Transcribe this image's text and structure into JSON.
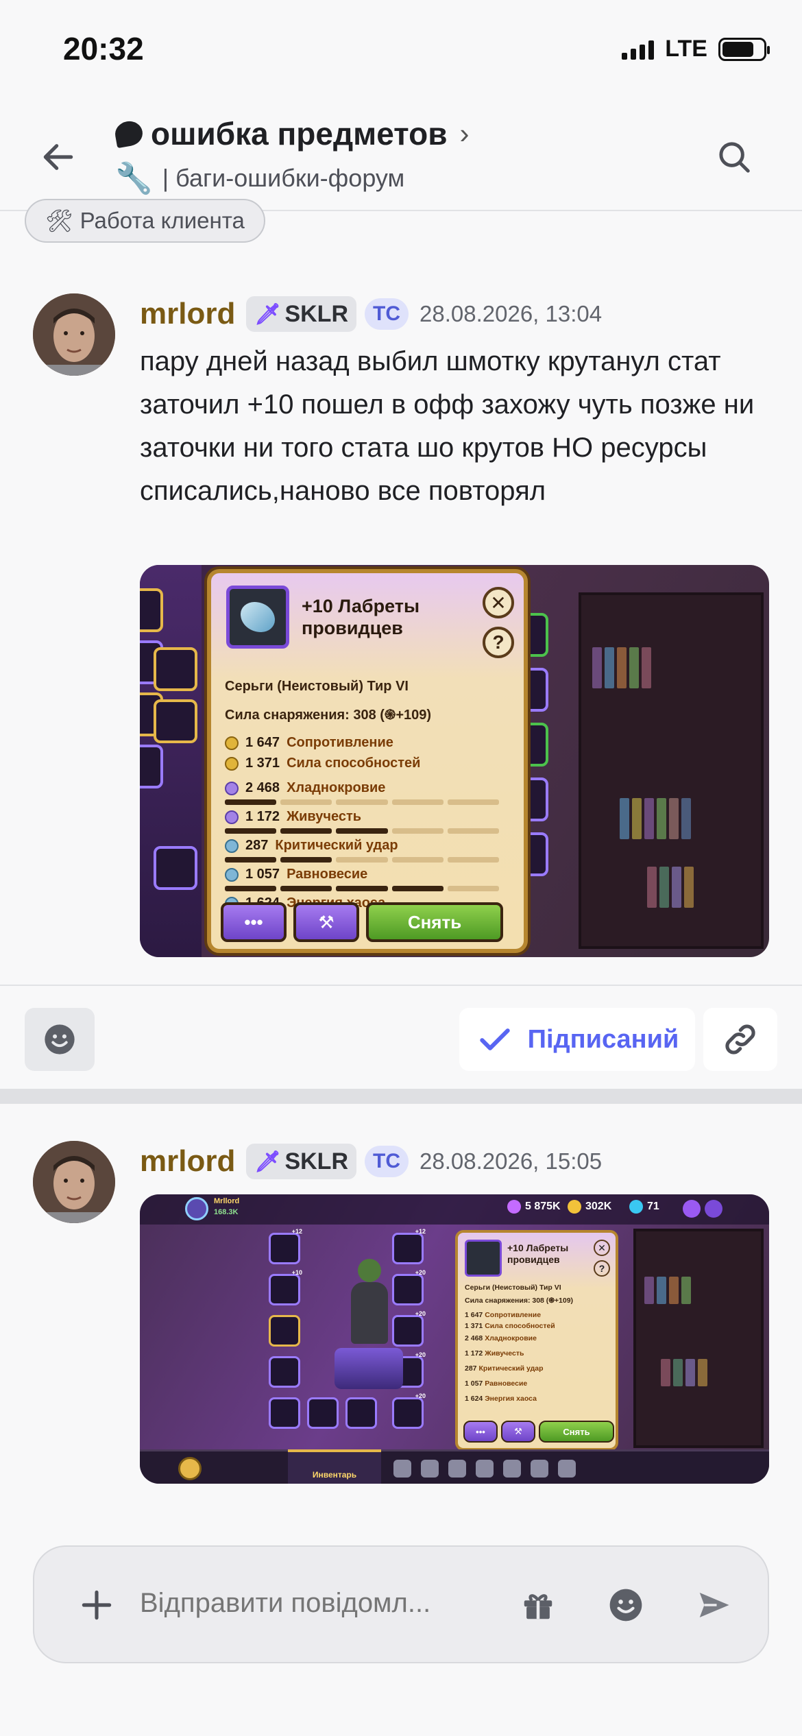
{
  "status_bar": {
    "time": "20:32",
    "network": "LTE"
  },
  "header": {
    "title": "ошибка предметов",
    "subtitle": "| баги-ошибки-форум"
  },
  "tag": {
    "label": "Работа клиента"
  },
  "messages": [
    {
      "username": "mrlord",
      "role": "SKLR",
      "op_badge": "TC",
      "timestamp": "28.08.2026, 13:04",
      "text": "пару дней назад выбил шмотку крутанул стат заточил +10 пошел в офф захожу чуть позже ни заточки ни того стата шо крутов НО ресурсы списались,наново все повторял"
    },
    {
      "username": "mrlord",
      "role": "SKLR",
      "op_badge": "TC",
      "timestamp": "28.08.2026, 15:05"
    }
  ],
  "game_card": {
    "title": "+10 Лабреты провидцев",
    "subtitle": "Серьги (Неистовый) Тир VI",
    "power": "Сила снаряжения: 308 (",
    "power_bonus": "+109)",
    "close": "✕",
    "help": "?",
    "stats": [
      {
        "value": "1 647",
        "label": "Сопротивление"
      },
      {
        "value": "1 371",
        "label": "Сила способностей"
      },
      {
        "value": "2 468",
        "label": "Хладнокровие"
      },
      {
        "value": "1 172",
        "label": "Живучесть"
      },
      {
        "value": "287",
        "label": "Критический удар"
      },
      {
        "value": "1 057",
        "label": "Равновесие"
      },
      {
        "value": "1 624",
        "label": "Энергия хаоса"
      }
    ],
    "more_button": "•••",
    "remove_button": "Снять"
  },
  "game_screen2": {
    "player_name": "Mrllord",
    "player_power": "168.3K",
    "gems": "5 875K",
    "gold": "302K",
    "crystals": "71",
    "inventory_tab": "Инвентарь",
    "slot_levels": [
      "+12",
      "+10",
      "+20",
      "+20",
      "+20",
      "+20",
      "+12"
    ]
  },
  "actions": {
    "follow_label": "Підписаний"
  },
  "composer": {
    "placeholder": "Відправити повідомл..."
  },
  "colors": {
    "accent": "#5865f2",
    "username": "#7a5a14",
    "badge_tc_bg": "#dfe2fb"
  }
}
